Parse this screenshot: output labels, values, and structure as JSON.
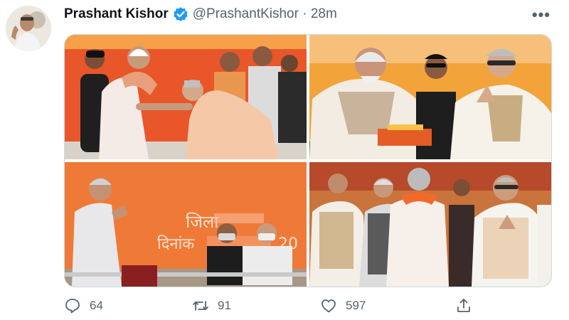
{
  "tweet": {
    "author_name": "Prashant Kishor",
    "handle_time": "@PrashantKishor · 28m",
    "more_icon": "more-horizontal-icon",
    "verified_icon": "verified-badge-icon",
    "accent_color": "#1d9bf0"
  },
  "media": {
    "photo_2_sign_text": "",
    "photo_3_banner_line1": "जिला",
    "photo_3_banner_line2": "दिनांक",
    "photo_3_banner_tail": "20"
  },
  "actions": {
    "reply_count": "64",
    "retweet_count": "91",
    "like_count": "597",
    "reply_icon": "reply-icon",
    "retweet_icon": "retweet-icon",
    "like_icon": "heart-icon",
    "share_icon": "share-icon"
  },
  "colors": {
    "text_secondary": "#536471",
    "border": "#cfd9de",
    "saffron": "#f26a2b"
  }
}
